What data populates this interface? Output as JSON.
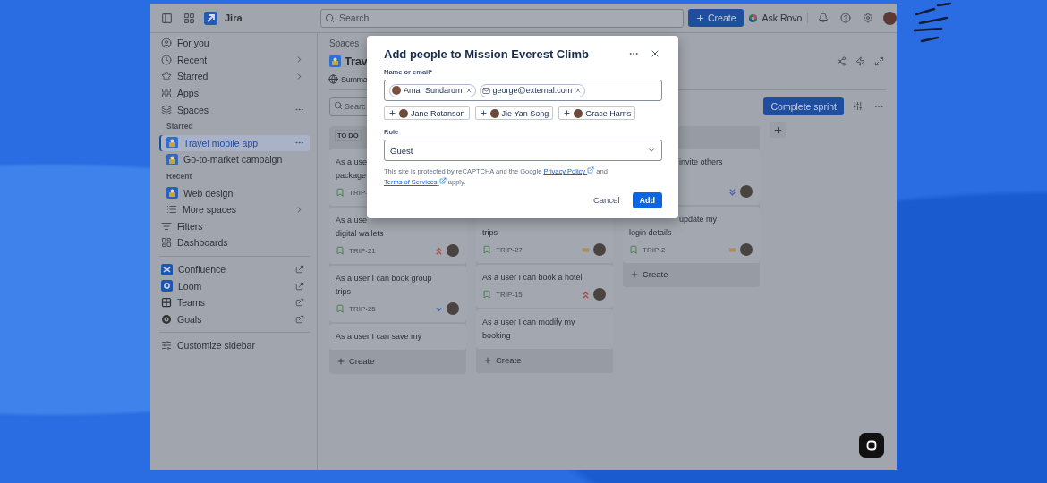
{
  "top_bar": {
    "app_name": "Jira",
    "search": {
      "placeholder": "Search"
    },
    "create_label": "Create",
    "ask_label": "Ask Rovo"
  },
  "sidebar": {
    "groups": [
      {
        "items": [
          {
            "kind": "nav",
            "label": "For you",
            "selected": false
          },
          {
            "kind": "nav",
            "label": "Recent",
            "expandable": true,
            "selected": false
          },
          {
            "kind": "nav",
            "label": "Starred",
            "expandable": true,
            "selected": false
          },
          {
            "kind": "nav",
            "label": "Apps",
            "selected": false
          },
          {
            "kind": "nav",
            "label": "Spaces",
            "actions": true,
            "selected": false
          },
          {
            "kind": "section",
            "label": "Starred"
          },
          {
            "kind": "space",
            "label": "Travel mobile app",
            "actions": true,
            "selected": true
          },
          {
            "kind": "space",
            "label": "Go-to-market campaign",
            "selected": false
          },
          {
            "kind": "section",
            "label": "Recent"
          },
          {
            "kind": "space",
            "label": "Web design",
            "selected": false
          },
          {
            "kind": "subnav",
            "label": "More spaces",
            "expandable": true,
            "selected": false
          },
          {
            "kind": "nav",
            "label": "Filters",
            "selected": false
          },
          {
            "kind": "nav",
            "label": "Dashboards",
            "selected": false
          }
        ]
      },
      {
        "items": [
          {
            "kind": "app",
            "label": "Confluence",
            "external": true,
            "selected": false
          },
          {
            "kind": "app",
            "label": "Loom",
            "external": true,
            "selected": false
          },
          {
            "kind": "app",
            "label": "Teams",
            "external": true,
            "selected": false
          },
          {
            "kind": "app",
            "label": "Goals",
            "external": true,
            "selected": false
          }
        ]
      },
      {
        "items": [
          {
            "kind": "nav",
            "label": "Customize sidebar",
            "selected": false
          }
        ]
      }
    ]
  },
  "space_header": {
    "breadcrumb": "Spaces",
    "title": "Trav",
    "tabs": [
      {
        "label": "Summa",
        "selected": false
      }
    ]
  },
  "board": {
    "search": {
      "placeholder": "Searc"
    },
    "complete_label": "Complete sprint",
    "columns": [
      {
        "title": "TO DO",
        "create_label": "Create",
        "cards": [
          {
            "kind": "plain",
            "lines": [
              "As a use",
              "package"
            ],
            "key": "TRIP-",
            "assigned": false
          },
          {
            "kind": "plain",
            "lines": [
              "As a use",
              "digital wallets"
            ],
            "key": "TRIP-21",
            "priority": {
              "kind": "highest"
            },
            "assigned": true
          },
          {
            "kind": "plain",
            "lines": [
              "As a user I can book group",
              "trips"
            ],
            "key": "TRIP-25",
            "priority": {
              "kind": "low"
            },
            "assigned": true
          },
          {
            "kind": "plain",
            "lines": [
              "As a user I can save my"
            ]
          }
        ]
      },
      {
        "create_label": "Create",
        "cards": [
          {
            "kind": "top_hidden",
            "lines": [
              "trips"
            ],
            "key": "TRIP-27",
            "priority": {
              "kind": "medium"
            },
            "assigned": true
          },
          {
            "kind": "plain",
            "lines": [
              "As a user I can book a hotel"
            ],
            "key": "TRIP-15",
            "priority": {
              "kind": "highest"
            },
            "assigned": true
          },
          {
            "kind": "plain",
            "lines": [
              "As a user I can modify my",
              "booking"
            ]
          }
        ]
      },
      {
        "create_label": "Create",
        "cards": [
          {
            "kind": "indent_first",
            "lines": [
              "invite others"
            ],
            "priority": {
              "kind": "lowest"
            },
            "assigned": true
          },
          {
            "kind": "indent_first",
            "lines": [
              "update my",
              "login details"
            ],
            "key": "TRIP-2",
            "priority": {
              "kind": "medium"
            },
            "assigned": true
          }
        ]
      }
    ]
  },
  "dialog": {
    "title": "Add people to Mission Everest Climb",
    "name_field": {
      "label": "Name or email*",
      "chips": [
        {
          "kind": "person",
          "label": "Amar Sundarum"
        },
        {
          "kind": "email",
          "label": "george@external.com"
        }
      ]
    },
    "suggestions": [
      {
        "label": "Jane Rotanson"
      },
      {
        "label": "Jie Yan Song"
      },
      {
        "label": "Grace Harris"
      }
    ],
    "role_field": {
      "label": "Role",
      "value": "Guest"
    },
    "notice": [
      {
        "kind": "text",
        "text": "This site is protected by reCAPTCHA and the Google "
      },
      {
        "kind": "link",
        "text": "Privacy Policy"
      },
      {
        "kind": "text",
        "text": " and "
      },
      {
        "kind": "link",
        "text": "Terms of Services"
      },
      {
        "kind": "text",
        "text": " apply."
      }
    ],
    "cancel_label": "Cancel",
    "add_label": "Add"
  }
}
